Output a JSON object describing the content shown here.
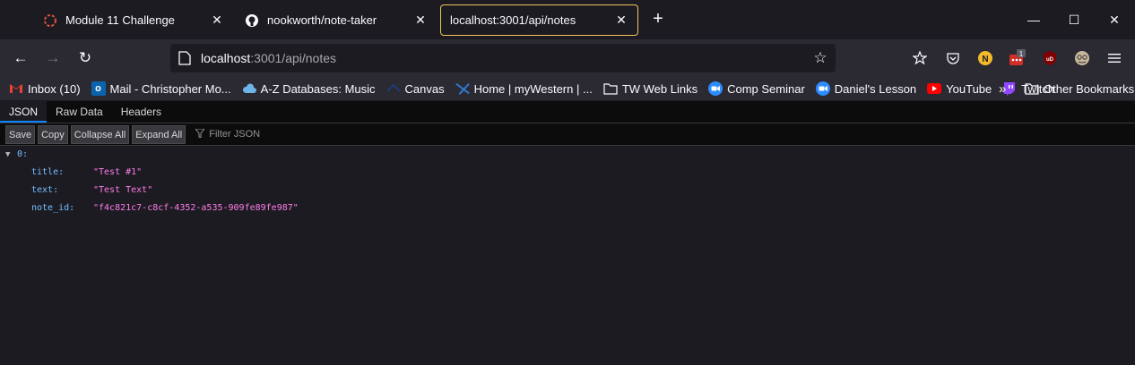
{
  "tabs": [
    {
      "title": "Module 11 Challenge",
      "icon": "circle-dashed-icon",
      "active": false
    },
    {
      "title": "nookworth/note-taker",
      "icon": "github-icon",
      "active": false
    },
    {
      "title": "localhost:3001/api/notes",
      "icon": "",
      "active": true
    }
  ],
  "new_tab_label": "+",
  "window_controls": {
    "minimize": "—",
    "maximize": "☐",
    "close": "✕"
  },
  "nav": {
    "back": "←",
    "forward": "→",
    "reload": "↻",
    "url_host": "localhost",
    "url_rest": ":3001/api/notes",
    "star": "☆"
  },
  "extensions": [
    {
      "name": "pocket-save-icon",
      "label": "⛉"
    },
    {
      "name": "pocket-icon",
      "label": "♡"
    },
    {
      "name": "n-extension-icon",
      "label": "N"
    },
    {
      "name": "lastpass-icon",
      "label": "•••",
      "badge": "1"
    },
    {
      "name": "ublock-icon",
      "label": "uD"
    },
    {
      "name": "profile-avatar-icon",
      "label": ""
    },
    {
      "name": "menu-icon",
      "label": "≡"
    }
  ],
  "bookmarks": [
    {
      "label": "Inbox (10)",
      "icon": "gmail-icon"
    },
    {
      "label": "Mail - Christopher Mo...",
      "icon": "outlook-icon"
    },
    {
      "label": "A-Z Databases: Music",
      "icon": "cloud-icon"
    },
    {
      "label": "Canvas",
      "icon": "canvas-icon"
    },
    {
      "label": "Home | myWestern | ...",
      "icon": "mywestern-icon"
    },
    {
      "label": "TW Web Links",
      "icon": "folder-icon"
    },
    {
      "label": "Comp Seminar",
      "icon": "zoom-icon"
    },
    {
      "label": "Daniel's Lesson",
      "icon": "zoom-icon"
    },
    {
      "label": "YouTube",
      "icon": "youtube-icon"
    },
    {
      "label": "Twitch",
      "icon": "twitch-icon"
    }
  ],
  "bookmarks_more": "»",
  "other_bookmarks": "Other Bookmarks",
  "viewer_tabs": [
    "JSON",
    "Raw Data",
    "Headers"
  ],
  "toolbar": {
    "save": "Save",
    "copy": "Copy",
    "collapse_all": "Collapse All",
    "expand_all": "Expand All",
    "filter_placeholder": "Filter JSON"
  },
  "json": {
    "index": "0:",
    "entries": [
      {
        "key": "title:",
        "value": "\"Test #1\""
      },
      {
        "key": "text:",
        "value": "\"Test Text\""
      },
      {
        "key": "note_id:",
        "value": "\"f4c821c7-c8cf-4352-a535-909fe89fe987\""
      }
    ]
  },
  "colors": {
    "active_tab_border": "#f1c55a",
    "json_key": "#75bfff",
    "json_string": "#ff7de9",
    "viewer_tab_accent": "#0a84ff"
  }
}
